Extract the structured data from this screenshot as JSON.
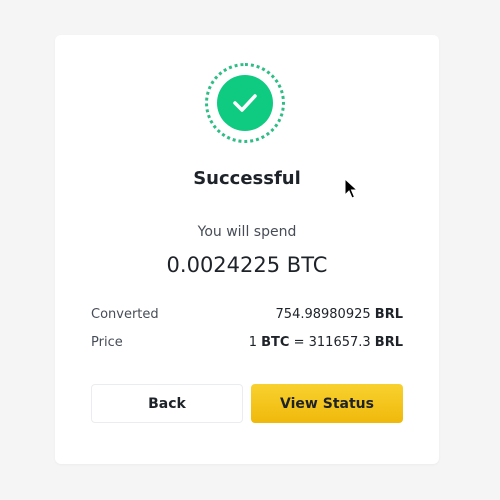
{
  "result": {
    "title": "Successful",
    "spend_label": "You will spend",
    "spend_amount": "0.0024225 BTC"
  },
  "details": {
    "converted": {
      "label": "Converted",
      "value": "754.98980925",
      "unit": "BRL"
    },
    "price": {
      "label": "Price",
      "lhs_amount": "1",
      "lhs_unit": "BTC",
      "equals": "=",
      "rhs_amount": "311657.3",
      "rhs_unit": "BRL"
    }
  },
  "buttons": {
    "back": "Back",
    "view_status": "View Status"
  },
  "icons": {
    "success": "check-circle-icon",
    "cursor": "mouse-pointer-icon"
  },
  "colors": {
    "success": "#0ecb81",
    "primary": "#f0b90b",
    "text": "#1e2329",
    "muted": "#474d57"
  }
}
